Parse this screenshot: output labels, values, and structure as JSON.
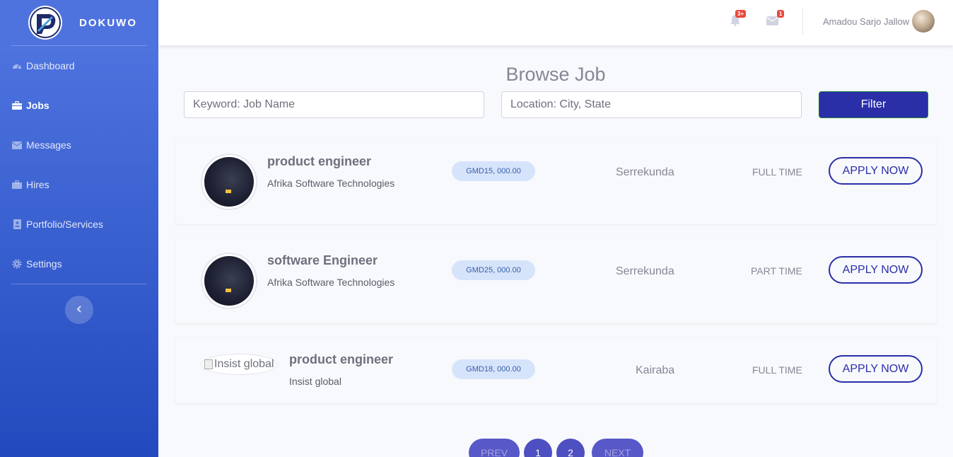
{
  "brand": {
    "name": "DOKUWO"
  },
  "sidebar": {
    "items": [
      {
        "label": "Dashboard",
        "icon": "dashboard-icon",
        "active": false
      },
      {
        "label": "Jobs",
        "icon": "briefcase-icon",
        "active": true
      },
      {
        "label": "Messages",
        "icon": "envelope-icon",
        "active": false
      },
      {
        "label": "Hires",
        "icon": "toolbox-icon",
        "active": false
      },
      {
        "label": "Portfolio/Services",
        "icon": "id-badge-icon",
        "active": false
      },
      {
        "label": "Settings",
        "icon": "gear-icon",
        "active": false
      }
    ]
  },
  "topbar": {
    "alerts_badge": "3+",
    "messages_badge": "1",
    "user_name": "Amadou Sarjo Jallow"
  },
  "main": {
    "title": "Browse Job",
    "search": {
      "keyword_placeholder": "Keyword: Job Name",
      "location_placeholder": "Location: City, State",
      "filter_label": "Filter"
    },
    "jobs": [
      {
        "title": "product engineer",
        "company": "Afrika Software Technologies",
        "salary": "GMD15, 000.00",
        "location": "Serrekunda",
        "type": "FULL TIME",
        "apply_label": "APPLY NOW",
        "image_alt": ""
      },
      {
        "title": "software Engineer",
        "company": "Afrika Software Technologies",
        "salary": "GMD25, 000.00",
        "location": "Serrekunda",
        "type": "PART TIME",
        "apply_label": "APPLY NOW",
        "image_alt": ""
      },
      {
        "title": "product engineer",
        "company": "Insist global",
        "salary": "GMD18, 000.00",
        "location": "Kairaba",
        "type": "FULL TIME",
        "apply_label": "APPLY NOW",
        "image_alt": "Insist global"
      }
    ],
    "pagination": {
      "prev": "PREV",
      "pages": [
        "1",
        "2"
      ],
      "next": "NEXT"
    }
  },
  "colors": {
    "sidebar_top": "#4e73df",
    "sidebar_bottom": "#224abe",
    "accent": "#2a2fa8",
    "badge": "#e74a3b"
  }
}
